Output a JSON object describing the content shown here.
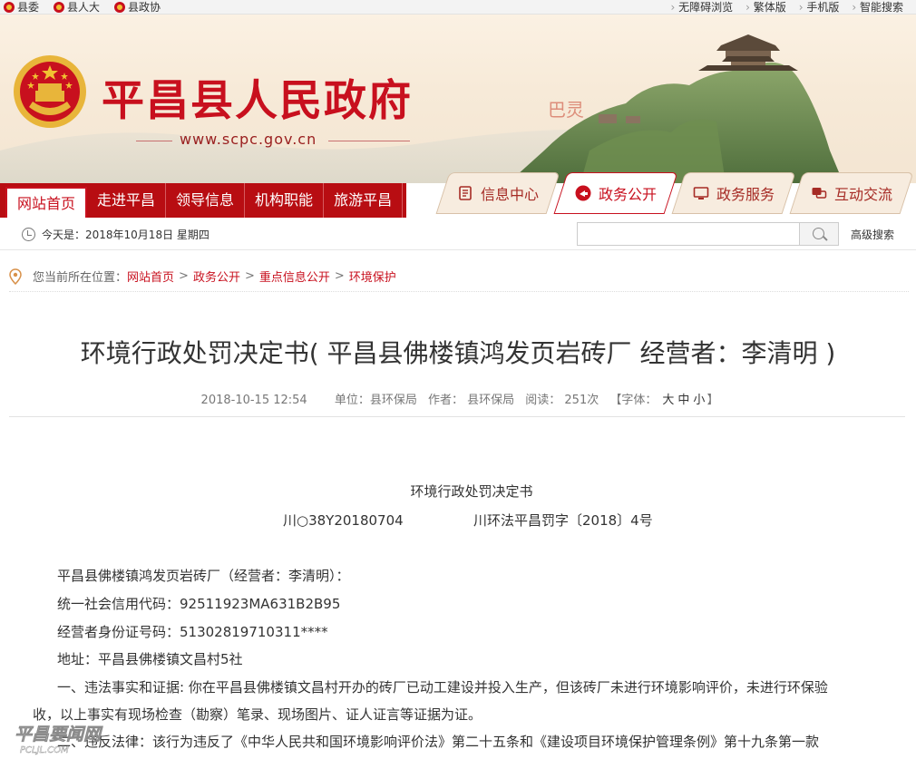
{
  "topbar": {
    "left": [
      {
        "label": "县委",
        "icon": "party-emblem-icon"
      },
      {
        "label": "县人大",
        "icon": "national-emblem-icon"
      },
      {
        "label": "县政协",
        "icon": "cppcc-emblem-icon"
      }
    ],
    "right": [
      "无障碍浏览",
      "繁体版",
      "手机版",
      "智能搜索"
    ]
  },
  "header": {
    "title": "平昌县人民政府",
    "url": "www.scpc.gov.cn"
  },
  "nav": [
    "网站首页",
    "走进平昌",
    "领导信息",
    "机构职能",
    "旅游平昌"
  ],
  "tabs": [
    {
      "label": "信息中心",
      "icon": "document-icon"
    },
    {
      "label": "政务公开",
      "icon": "megaphone-icon"
    },
    {
      "label": "政务服务",
      "icon": "monitor-icon"
    },
    {
      "label": "互动交流",
      "icon": "chat-icon"
    }
  ],
  "info": {
    "today": "今天是：2018年10月18日  星期四",
    "search_placeholder": "",
    "advanced": "高级搜索"
  },
  "breadcrumb": {
    "label": "您当前所在位置：",
    "items": [
      "网站首页",
      "政务公开",
      "重点信息公开",
      "环境保护"
    ]
  },
  "article": {
    "title": "环境行政处罚决定书( 平昌县佛楼镇鸿发页岩砖厂 经营者：李清明 )",
    "date": "2018-10-15 12:54",
    "unit": "单位：县环保局",
    "author": "作者： 县环保局",
    "reads": "阅读： 251次",
    "font_label": "【字体：",
    "font_sizes": [
      "大",
      "中",
      "小"
    ],
    "font_end": "】",
    "doc_heading": "环境行政处罚决定书",
    "doc_no1": "川○38Y20180704",
    "doc_no2": "川环法平昌罚字〔2018〕4号",
    "paragraphs": [
      "平昌县佛楼镇鸿发页岩砖厂（经营者：李清明）：",
      "统一社会信用代码：92511923MA631B2B95",
      "经营者身份证号码：51302819710311****",
      "地址：平昌县佛楼镇文昌村5社",
      "一、违法事实和证据: 你在平昌县佛楼镇文昌村开办的砖厂已动工建设并投入生产，但该砖厂未进行环境影响评价，未进行环保验",
      "收，以上事实有现场检查（勘察）笔录、现场图片、证人证言等证据为证。",
      "二、违反法律：该行为违反了《中华人民共和国环境影响评价法》第二十五条和《建设项目环境保护管理条例》第十九条第一款"
    ]
  },
  "watermark": {
    "line1": "平昌要闻网",
    "line2": "PCLJL.COM"
  },
  "colors": {
    "brand_red": "#c8101e",
    "nav_red": "#b80d12",
    "header_bg": "#f7ead8"
  }
}
